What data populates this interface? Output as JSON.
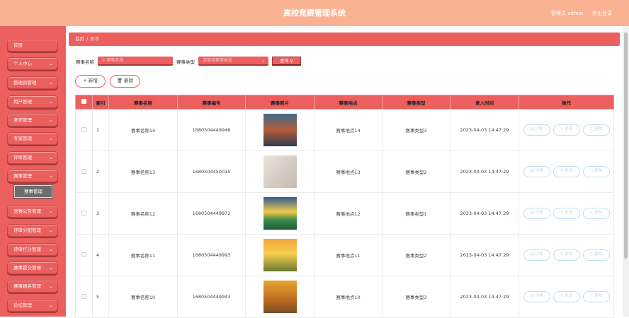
{
  "header": {
    "title": "高校竞赛管理系统",
    "admin_label": "管理员 admin",
    "logout_label": "退出登录"
  },
  "sidebar": {
    "items": [
      {
        "label": "首页",
        "chevron": false
      },
      {
        "label": "个人中心",
        "chevron": true
      },
      {
        "label": "管理员管理",
        "chevron": true
      },
      {
        "label": "用户管理",
        "chevron": true
      },
      {
        "label": "老师管理",
        "chevron": true
      },
      {
        "label": "专家管理",
        "chevron": true
      },
      {
        "label": "评审管理",
        "chevron": true
      },
      {
        "label": "赛事管理",
        "chevron": true
      },
      {
        "label": "竞赛公告管理",
        "chevron": true
      },
      {
        "label": "评审分配管理",
        "chevron": true
      },
      {
        "label": "评审打分管理",
        "chevron": true
      },
      {
        "label": "赛事提交管理",
        "chevron": true
      },
      {
        "label": "赛事报名管理",
        "chevron": true
      },
      {
        "label": "论坛管理",
        "chevron": true
      }
    ],
    "subitem": "赛事管理"
  },
  "breadcrumb": {
    "home": "首页",
    "sep": "/",
    "current": "赛事"
  },
  "search": {
    "name_label": "赛事名称",
    "name_placeholder": "赛事名称",
    "type_label": "赛事类型",
    "type_placeholder": "请选择赛事类型",
    "query_label": "查询"
  },
  "actions": {
    "add_label": "新增",
    "delete_label": "删除"
  },
  "table": {
    "headers": [
      "索引",
      "赛事名称",
      "赛事编号",
      "赛事照片",
      "赛事地点",
      "赛事类型",
      "录入时间",
      "操作"
    ],
    "rows": [
      {
        "index": "1",
        "name": "赛事名称14",
        "code": "1680504449946",
        "photo": "lake-tree",
        "place": "赛事地点14",
        "type": "赛事类型3",
        "time": "2023-04-03 14:47:29"
      },
      {
        "index": "2",
        "name": "赛事名称13",
        "code": "1680504450015",
        "photo": "blossom",
        "place": "赛事地点13",
        "type": "赛事类型2",
        "time": "2023-04-03 14:47:29"
      },
      {
        "index": "3",
        "name": "赛事名称12",
        "code": "1680504449972",
        "photo": "sunrise-lake",
        "place": "赛事地点12",
        "type": "赛事类型1",
        "time": "2023-04-03 14:47:29"
      },
      {
        "index": "4",
        "name": "赛事名称11",
        "code": "1680504449993",
        "photo": "sunset-field",
        "place": "赛事地点11",
        "type": "赛事类型2",
        "time": "2023-04-03 14:47:29"
      },
      {
        "index": "5",
        "name": "赛事名称10",
        "code": "1680504449943",
        "photo": "autumn-road",
        "place": "赛事地点10",
        "type": "赛事类型3",
        "time": "2023-04-03 14:47:29"
      }
    ],
    "op_labels": {
      "detail": "详情",
      "edit": "修改",
      "delete": "删除"
    }
  },
  "colors": {
    "accent": "#eb5f5e",
    "header": "#fbb292",
    "op_border": "#bfe0ec"
  }
}
